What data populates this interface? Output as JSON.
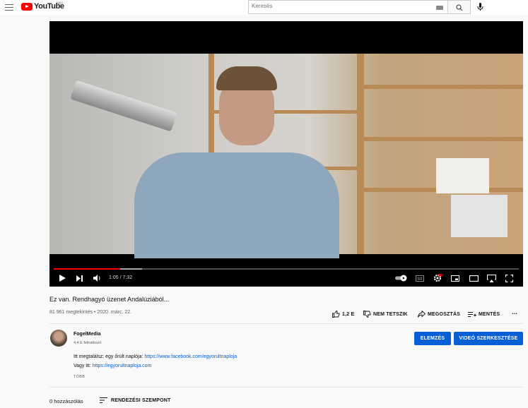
{
  "header": {
    "logo_text": "YouTube",
    "logo_country": "HU",
    "search_placeholder": "Keresés"
  },
  "player": {
    "time_current": "1:05",
    "time_total": "7:32",
    "time_display": "1:05 / 7:32",
    "progress_played": 0.143,
    "progress_loaded": 0.19
  },
  "video": {
    "title": "Ez van. Rendhagyó üzenet Andalúziából...",
    "views_date": "81 961 megtekintés • 2020. márc. 22."
  },
  "actions": {
    "like_count": "1,2 E",
    "dislike_label": "NEM TETSZIK",
    "share_label": "MEGOSZTÁS",
    "save_label": "MENTÉS",
    "more_label": "..."
  },
  "channel": {
    "name": "FogelMedia",
    "subscribers": "4,4 E feliratkozó",
    "analytics_button": "ELEMZÉS",
    "edit_button": "VIDEÓ SZERKESZTÉSE"
  },
  "description": {
    "line1_text": "Itt megtalálsz: egy őrült naplója: ",
    "line1_link": "https://www.facebook.com/egyorultnaploja",
    "line2_text": "Vagy itt: ",
    "line2_link": "https://egyorultnaploja.com",
    "more_label": "TÖBB"
  },
  "comments": {
    "count_label": "0 hozzászólás",
    "sort_label": "RENDEZÉSI SZEMPONT"
  },
  "colors": {
    "accent_blue": "#065fd4",
    "brand_red": "#ff0000",
    "progress_red": "#ff0000"
  }
}
